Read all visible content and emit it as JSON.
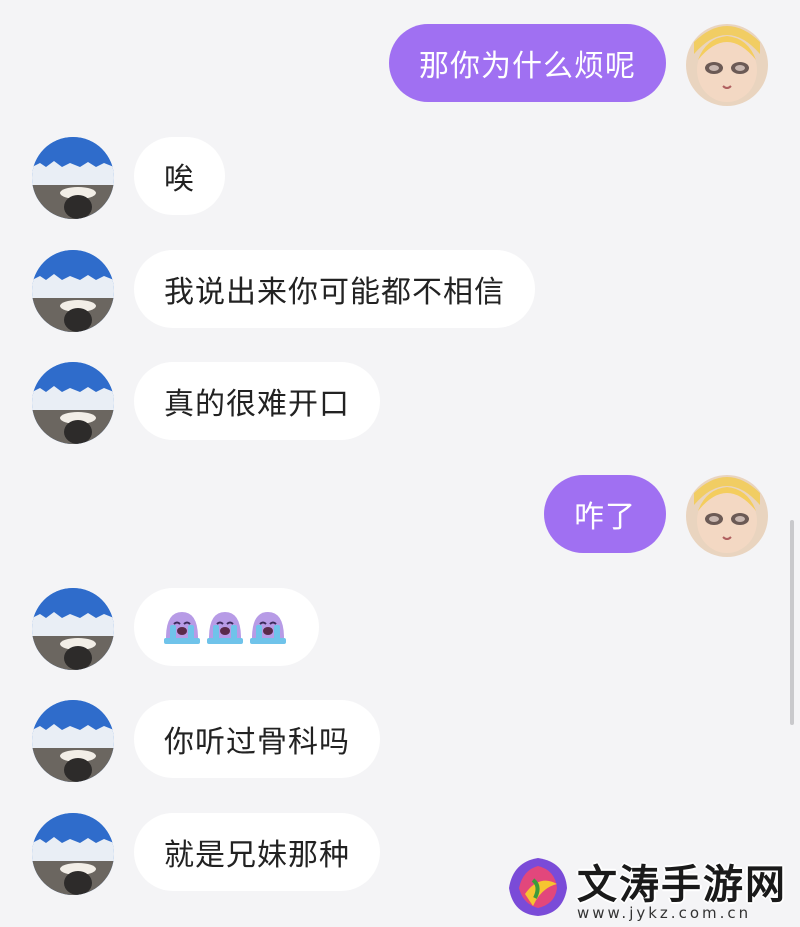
{
  "chat": {
    "messages": [
      {
        "side": "out",
        "text": "那你为什么烦呢"
      },
      {
        "side": "in",
        "text": "唉"
      },
      {
        "side": "in",
        "text": "我说出来你可能都不相信"
      },
      {
        "side": "in",
        "text": "真的很难开口"
      },
      {
        "side": "out",
        "text": "咋了"
      },
      {
        "side": "in",
        "text": "😭😭😭",
        "emoji": "loudly-crying-face",
        "count": 3
      },
      {
        "side": "in",
        "text": "你听过骨科吗"
      },
      {
        "side": "in",
        "text": "就是兄妹那种"
      }
    ]
  },
  "watermark": {
    "title": "文涛手游网",
    "url": "www.jykz.com.cn"
  },
  "colors": {
    "background": "#f4f4f6",
    "outgoing_bubble": "#a070f2",
    "incoming_bubble": "#ffffff"
  }
}
